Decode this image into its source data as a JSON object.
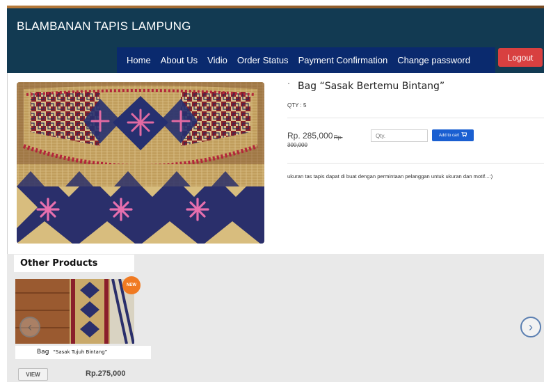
{
  "header": {
    "brand": "BLAMBANAN TAPIS LAMPUNG",
    "nav": [
      "Home",
      "About Us",
      "Vidio",
      "Order Status",
      "Payment Confirmation",
      "Change password"
    ],
    "logout_label": "Logout",
    "colors": {
      "header_bg": "#123a52",
      "nav_bg": "#0a2a6e",
      "logout_bg": "#d84040"
    }
  },
  "product": {
    "bullet": "·",
    "title": "Bag “Sasak Bertemu Bintang”",
    "qty_label": "QTY : 5",
    "price": "Rp. 285,000",
    "old_price_prefix": "Rp.",
    "old_price": "300,000",
    "qty_placeholder": "Qty.",
    "add_to_cart_label": "Add to cart",
    "description": "ukuran tas tapis dapat di buat dengan permintaan pelanggan untuk ukuran dan motif...:)"
  },
  "other_products": {
    "title": "Other Products",
    "items": [
      {
        "badge": "NEW",
        "name_prefix": "Bag",
        "name_rest": "“Sasak Tujuh Bintang”",
        "view_label": "VIEW",
        "price": "Rp.275,000"
      }
    ],
    "prev_icon": "chevron-left-icon",
    "next_icon": "chevron-right-icon"
  }
}
